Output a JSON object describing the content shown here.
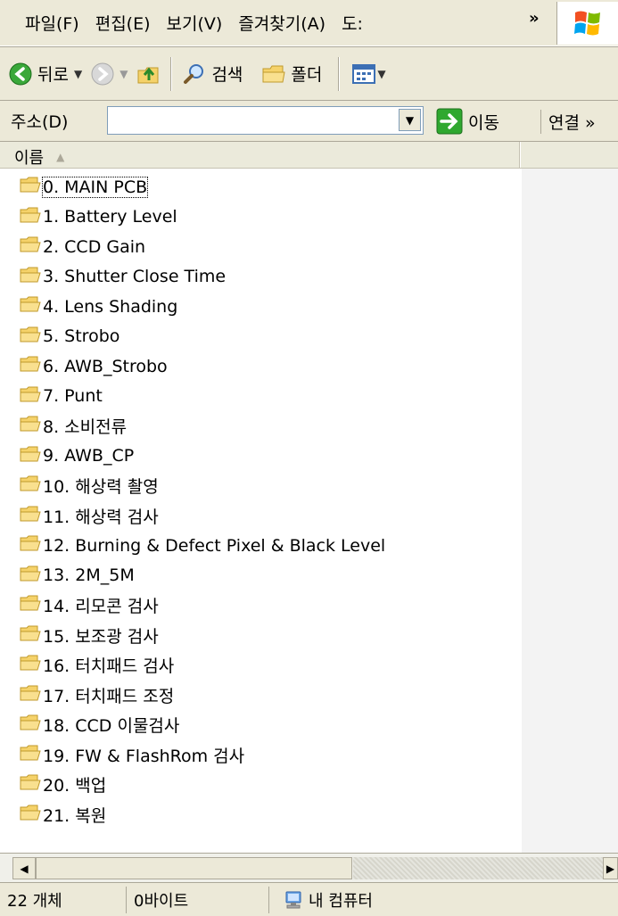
{
  "menu": [
    "파일(F)",
    "편집(E)",
    "보기(V)",
    "즐겨찾기(A)",
    "도:"
  ],
  "menu_more": "»",
  "toolbar": {
    "back_label": "뒤로",
    "search_label": "검색",
    "folders_label": "폴더"
  },
  "address": {
    "label": "주소(D)",
    "value": "",
    "go_label": "이동",
    "links_label": "연결 »"
  },
  "list": {
    "column_name": "이름",
    "rows": [
      "0. MAIN PCB",
      "1. Battery Level",
      "2. CCD Gain",
      "3. Shutter Close Time",
      "4. Lens Shading",
      "5. Strobo",
      "6. AWB_Strobo",
      "7. Punt",
      "8. 소비전류",
      "9. AWB_CP",
      "10. 해상력 촬영",
      "11. 해상력 검사",
      "12. Burning & Defect Pixel & Black Level",
      "13. 2M_5M",
      "14. 리모콘 검사",
      "15. 보조광 검사",
      "16. 터치패드 검사",
      "17. 터치패드 조정",
      "18. CCD 이물검사",
      "19. FW & FlashRom 검사",
      "20. 백업",
      "21. 복원"
    ]
  },
  "status": {
    "count": "22 개체",
    "size": "0바이트",
    "location": "내 컴퓨터"
  }
}
